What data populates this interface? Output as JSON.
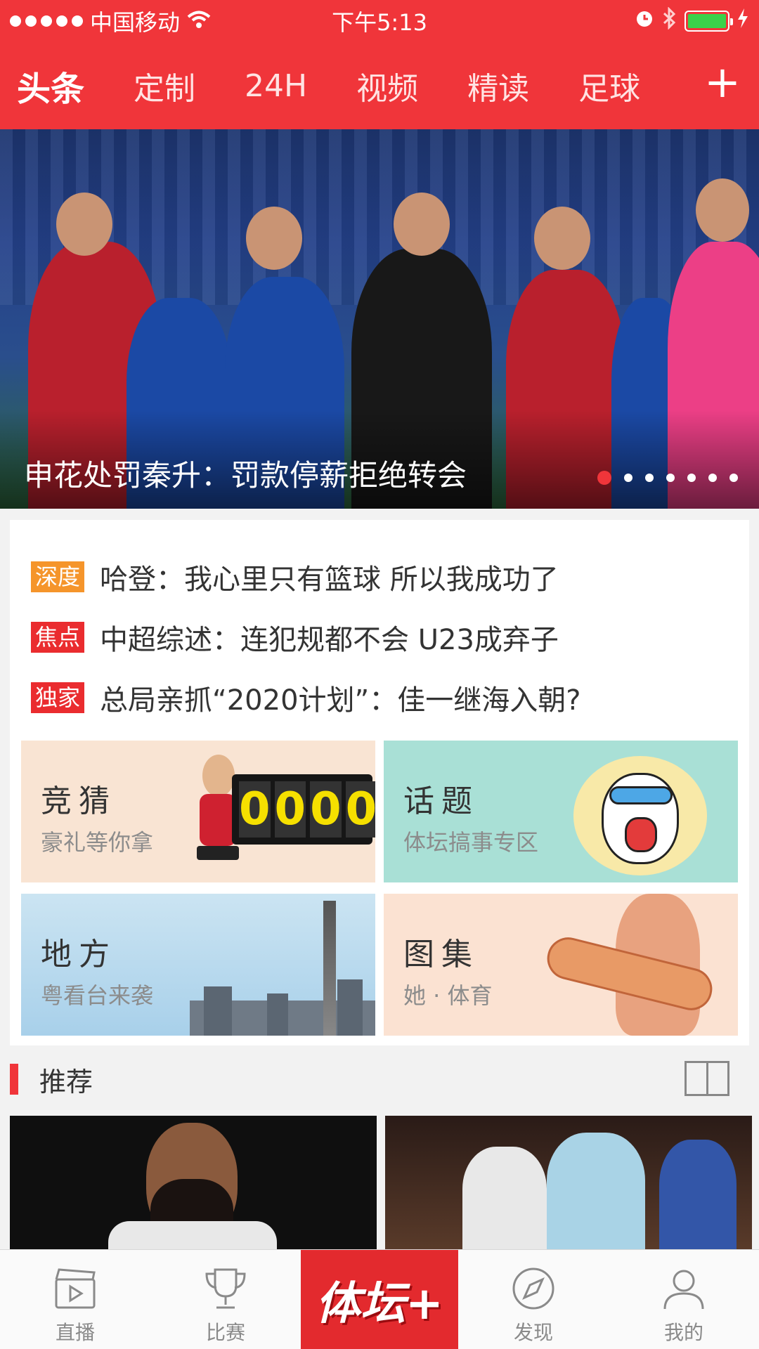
{
  "status_bar": {
    "carrier": "中国移动",
    "time": "下午5:13"
  },
  "nav": {
    "tabs": [
      "头条",
      "定制",
      "24H",
      "视频",
      "精读",
      "足球"
    ],
    "active_index": 0,
    "add_symbol": "+"
  },
  "banner": {
    "caption": "申花处罚秦升：罚款停薪拒绝转会",
    "page_count": 7,
    "current_page": 1
  },
  "headlines": [
    {
      "tag": "深度",
      "tag_color": "#f5952b",
      "text": "哈登：我心里只有篮球 所以我成功了"
    },
    {
      "tag": "焦点",
      "tag_color": "#ea2c2f",
      "text": "中超综述：连犯规都不会 U23成弃子"
    },
    {
      "tag": "独家",
      "tag_color": "#ea2c2f",
      "text": "总局亲抓“2020计划”：佳一继海入朝?"
    }
  ],
  "cards": {
    "guess": {
      "title": "竞猜",
      "subtitle": "豪礼等你拿",
      "score": [
        "0",
        "0",
        "0",
        "0"
      ]
    },
    "topic": {
      "title": "话题",
      "subtitle": "体坛搞事专区"
    },
    "local": {
      "title": "地方",
      "subtitle": "粤看台来袭"
    },
    "gallery": {
      "title": "图集",
      "subtitle": "她 · 体育"
    }
  },
  "recommend": {
    "title": "推荐"
  },
  "tabbar": {
    "live": "直播",
    "match": "比赛",
    "center_logo": "体坛+",
    "discover": "发现",
    "me": "我的"
  },
  "colors": {
    "brand_red": "#f0353a",
    "tab_center_red": "#e32a2e",
    "battery_green": "#3ad24a"
  }
}
